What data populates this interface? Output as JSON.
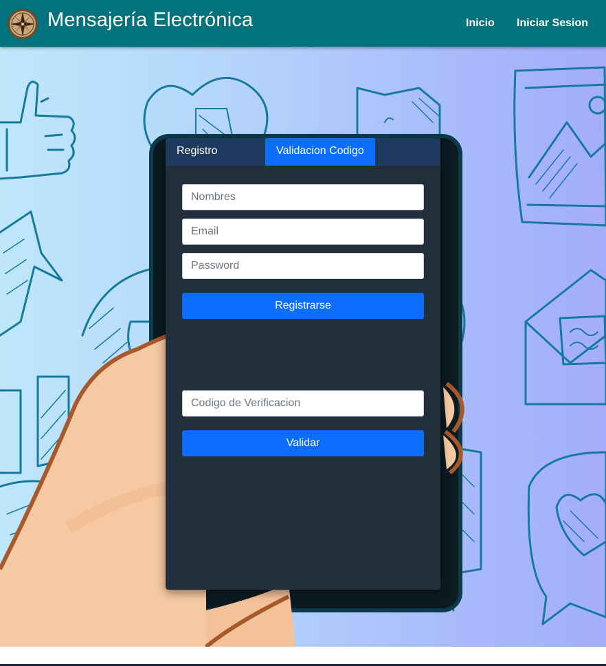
{
  "navbar": {
    "brand_title": "Mensajería Electrónica",
    "logo_icon": "compass-rose-logo",
    "links": {
      "inicio": "Inicio",
      "iniciar_sesion": "Iniciar Sesion"
    }
  },
  "hero": {
    "background_icons": [
      "thumbs-up-icon",
      "heart-icon",
      "chat-bubble-icon",
      "picture-frame-icon",
      "chart-arrow-icon",
      "envelope-icon",
      "phone-in-hand-icon",
      "heart-speech-bubble-icon"
    ]
  },
  "card": {
    "tabs": {
      "registro": "Registro",
      "validacion": "Validacion Codigo"
    },
    "register_form": {
      "nombres_placeholder": "Nombres",
      "email_placeholder": "Email",
      "password_placeholder": "Password",
      "submit_label": "Registrarse"
    },
    "verify_form": {
      "codigo_placeholder": "Codigo de Verificacion",
      "submit_label": "Validar"
    }
  },
  "colors": {
    "navbar": "#02737c",
    "card": "#222e3c",
    "tab_bar": "#1f3a5f",
    "primary": "#0d6efd",
    "sketch_stroke": "#167a9e"
  }
}
